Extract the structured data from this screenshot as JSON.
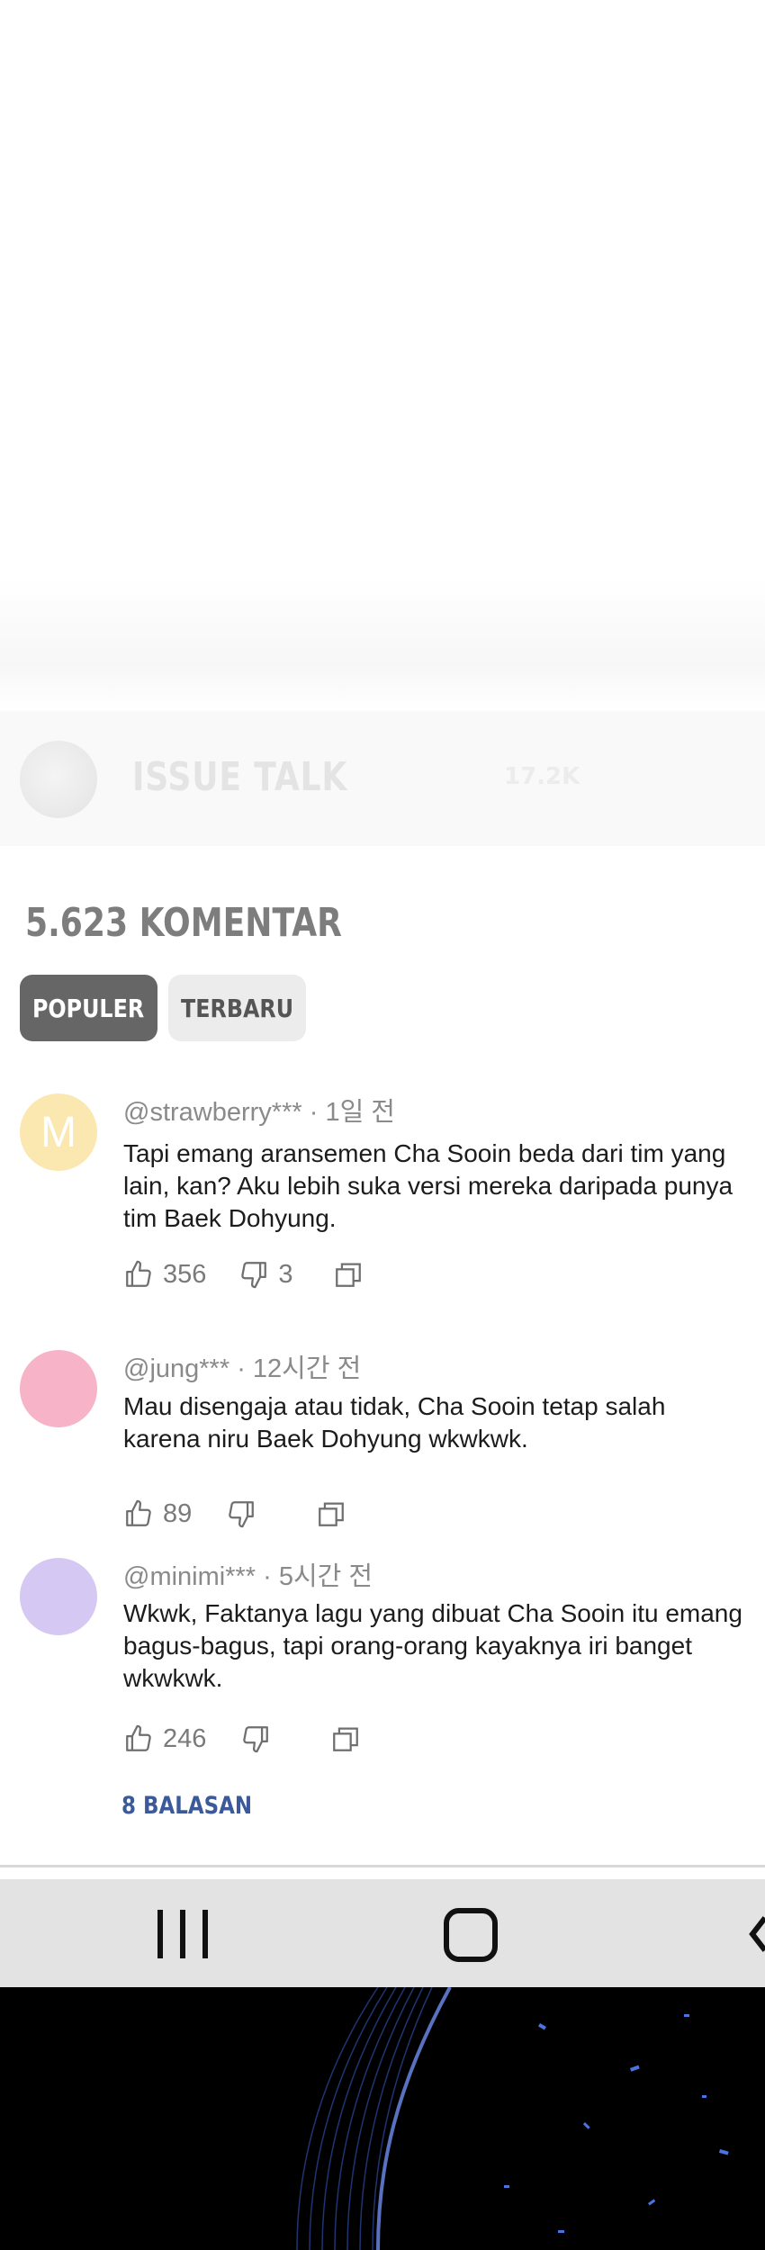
{
  "issue_talk": {
    "title": "ISSUE TALK",
    "count": "17.2K"
  },
  "comments_header": {
    "count_label": "5.623 KOMENTAR"
  },
  "tabs": [
    {
      "label": "POPULER",
      "active": true
    },
    {
      "label": "TERBARU",
      "active": false
    }
  ],
  "comments": [
    {
      "avatar_letter": "M",
      "avatar_color": "#fbe7b0",
      "user": "@strawberry***",
      "time": "1일 전",
      "text": "Tapi emang aransemen Cha Sooin beda dari tim yang lain, kan? Aku lebih suka versi mereka daripada punya tim Baek Dohyung.",
      "likes": "356",
      "dislikes": "3"
    },
    {
      "avatar_letter": "",
      "avatar_color": "#f7b3c8",
      "user": "@jung***",
      "time": "12시간 전",
      "text": "Mau disengaja atau tidak, Cha Sooin tetap salah karena niru Baek Dohyung wkwkwk.",
      "likes": "89",
      "dislikes": ""
    },
    {
      "avatar_letter": "",
      "avatar_color": "#d5c8f2",
      "user": "@minimi***",
      "time": "5시간 전",
      "text": "Wkwk, Faktanya lagu yang dibuat Cha Sooin itu emang bagus-bagus, tapi orang-orang kayaknya iri banget wkwkwk.",
      "likes": "246",
      "dislikes": ""
    }
  ],
  "replies_label": "8 BALASAN",
  "colors": {
    "tab_active": "#666666",
    "tab_inactive": "#ececec",
    "replies": "#3c5a9a",
    "navbar": "#e3e3e3"
  },
  "icons": {
    "like": "thumbs-up-icon",
    "dislike": "thumbs-down-icon",
    "reply": "reply-icon",
    "nav_recents": "recent-apps-icon",
    "nav_home": "home-icon",
    "nav_back": "back-icon"
  }
}
